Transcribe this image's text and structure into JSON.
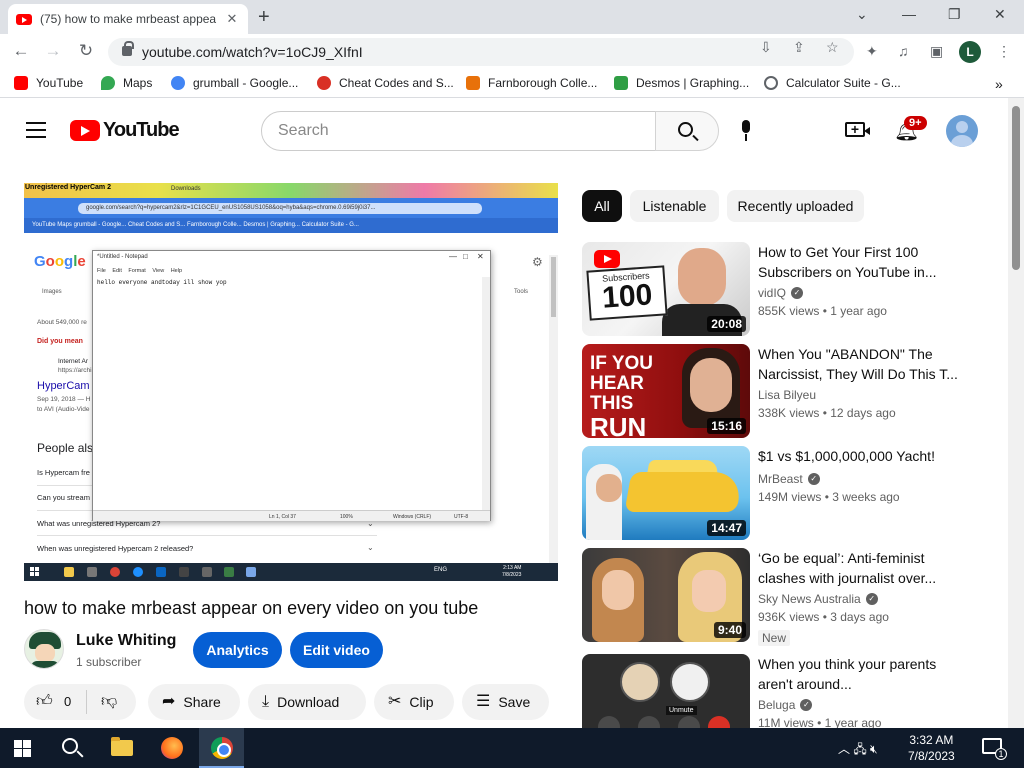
{
  "browser": {
    "tab_title": "(75) how to make mrbeast appea",
    "tab_close": "✕",
    "new_tab": "+",
    "url": "youtube.com/watch?v=1oCJ9_XIfnI",
    "profile_initial": "L",
    "window_controls": [
      "⌄",
      "—",
      "❐",
      "✕"
    ]
  },
  "bookmarks": [
    {
      "label": "YouTube",
      "color": "#ff0000"
    },
    {
      "label": "Maps",
      "color": "#34a853"
    },
    {
      "label": "grumball - Google...",
      "color": "#4285f4"
    },
    {
      "label": "Cheat Codes and S...",
      "color": "#d93025"
    },
    {
      "label": "Farnborough Colle...",
      "color": "#e8710a"
    },
    {
      "label": "Desmos | Graphing...",
      "color": "#2f9e44"
    },
    {
      "label": "Calculator Suite - G...",
      "color": "#5f6368"
    }
  ],
  "header": {
    "logo_text": "YouTube",
    "search_placeholder": "Search",
    "notification_count": "9+"
  },
  "chips": [
    "All",
    "Listenable",
    "Recently uploaded"
  ],
  "player": {
    "recording_title": "Unregistered HyperCam 2",
    "downloads_tab": "Downloads",
    "inner_url": "google.com/search?q=hypercam2&rlz=1C1GCEU_enUS1058US1058&oq=hyba&aqs=chrome.0.69i59j0i37...",
    "inner_bookmarks": "YouTube    Maps    grumball - Google...    Cheat Codes and S...    Farnborough Colle...    Desmos | Graphing...    Calculator Suite - G...",
    "google": [
      "G",
      "o",
      "o",
      "g",
      "l",
      "e"
    ],
    "images_tab": "Images",
    "tools": "Tools",
    "results_count": "About 549,000 re",
    "did_you_mean": "Did you mean",
    "result_site": "Internet Ar",
    "result_url": "https://archi",
    "result_title": "HyperCam 2",
    "result_date": "Sep 19, 2018 — H",
    "result_snippet": "to AVI (Audio-Vide",
    "people_also": "People also",
    "questions": [
      "Is Hypercam fre",
      "Can you stream",
      "What was unregistered Hypercam 2?",
      "When was unregistered Hypercam 2 released?"
    ],
    "notepad_title": "*Untitled - Notepad",
    "notepad_menu": "File Edit Format View Help",
    "notepad_text": "hello everyone andtoday ill show yop",
    "notepad_status": [
      "Ln 1, Col 37",
      "100%",
      "Windows (CRLF)",
      "UTF-8"
    ],
    "inner_time": "2:13 AM",
    "inner_date": "7/8/2023",
    "inner_tray": "ENG"
  },
  "video": {
    "title": "how to make mrbeast appear on every video on you tube",
    "channel": "Luke Whiting",
    "subscribers": "1 subscriber",
    "analytics_label": "Analytics",
    "edit_label": "Edit video",
    "like_count": "0",
    "share_label": "Share",
    "download_label": "Download",
    "clip_label": "Clip",
    "save_label": "Save"
  },
  "recommendations": [
    {
      "title": "How to Get Your First 100 Subscribers on YouTube in...",
      "channel": "vidIQ",
      "verified": true,
      "meta": "855K views  •  1 year ago",
      "duration": "20:08",
      "thumb_text_1": "Subscribers",
      "thumb_text_2": "100"
    },
    {
      "title": "When You \"ABANDON\" The Narcissist, They Will Do This T...",
      "channel": "Lisa Bilyeu",
      "verified": false,
      "meta": "338K views  •  12 days ago",
      "duration": "15:16",
      "thumb_text_1": "IF YOU HEAR THIS",
      "thumb_text_2": "RUN"
    },
    {
      "title": "$1 vs $1,000,000,000 Yacht!",
      "channel": "MrBeast",
      "verified": true,
      "meta": "149M views  •  3 weeks ago",
      "duration": "14:47"
    },
    {
      "title": "‘Go be equal’: Anti-feminist clashes with journalist over...",
      "channel": "Sky News Australia",
      "verified": true,
      "meta": "936K views  •  3 days ago",
      "duration": "9:40",
      "badge": "New"
    },
    {
      "title": "When you think your parents aren't around...",
      "channel": "Beluga",
      "verified": true,
      "meta": "11M views  •  1 year ago",
      "thumb_text_1": "Unmute"
    }
  ],
  "taskbar": {
    "time": "3:32 AM",
    "date": "7/8/2023",
    "notifications": "1"
  }
}
